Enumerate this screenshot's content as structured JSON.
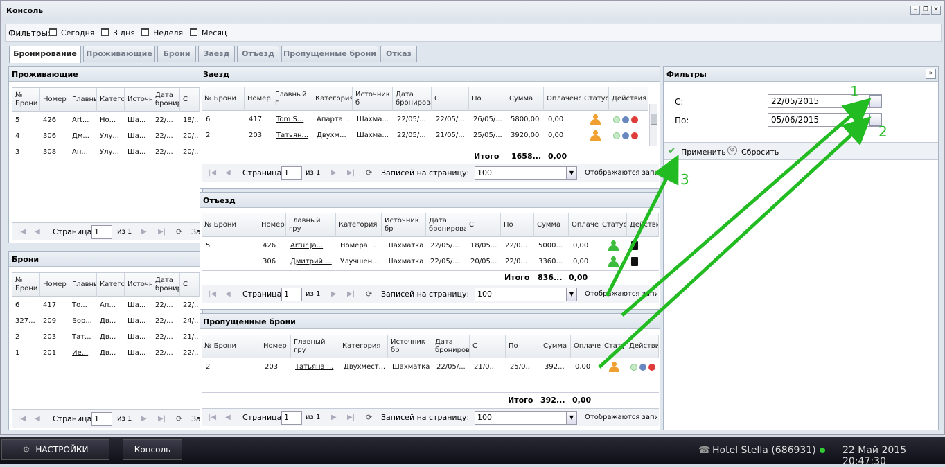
{
  "window": {
    "title": "Консоль"
  },
  "filterbar": {
    "label": "Фильтры:",
    "items": [
      "Сегодня",
      "3 дня",
      "Неделя",
      "Месяц"
    ]
  },
  "tabs": [
    "Бронирование",
    "Проживающие",
    "Брони",
    "Заезд",
    "Отъезд",
    "Пропущенные брони",
    "Отказ"
  ],
  "residents": {
    "title": "Проживающие",
    "headers": [
      "№ Брони",
      "Номер",
      "Главны",
      "Катего",
      "Источн",
      "Дата бронир",
      "С"
    ],
    "rows": [
      [
        "5",
        "426",
        "Art...",
        "Но...",
        "Ша...",
        "22/...",
        "18/..."
      ],
      [
        "4",
        "306",
        "Дм...",
        "Улу...",
        "Ша...",
        "22/...",
        "20/..."
      ],
      [
        "3",
        "308",
        "Ан...",
        "Улу...",
        "Ша...",
        "22/...",
        "20/..."
      ]
    ]
  },
  "bookings": {
    "title": "Брони",
    "headers": [
      "№ Брони",
      "Номер",
      "Главны",
      "Катего",
      "Источн",
      "Дата бронир",
      "С"
    ],
    "rows": [
      [
        "6",
        "417",
        "То...",
        "Ап...",
        "Ша...",
        "22/...",
        "22/..."
      ],
      [
        "327...",
        "209",
        "Бор...",
        "Дв...",
        "Ша...",
        "22/...",
        "24/..."
      ],
      [
        "2",
        "203",
        "Тат...",
        "Дв...",
        "Ша...",
        "22/...",
        "21/..."
      ],
      [
        "1",
        "201",
        "Ие...",
        "Дв...",
        "Ша...",
        "22/...",
        "22/..."
      ]
    ]
  },
  "arrival": {
    "title": "Заезд",
    "headers": [
      "№ Брони",
      "Номер",
      "Главный г",
      "Категория",
      "Источник б",
      "Дата бронирования",
      "С",
      "По",
      "Сумма",
      "Оплачено",
      "Статус",
      "Действия"
    ],
    "rows": [
      [
        "6",
        "417",
        "Tom S...",
        "Апарта...",
        "Шахма...",
        "22/05/...",
        "22/05/...",
        "26/05/...",
        "5800,00",
        "0,00"
      ],
      [
        "2",
        "203",
        "Татьян...",
        "Двухм...",
        "Шахма...",
        "22/05/...",
        "21/05/...",
        "25/05/...",
        "3920,00",
        "0,00"
      ]
    ],
    "total_label": "Итого",
    "total_sum": "1658...",
    "total_paid": "0,00"
  },
  "departure": {
    "title": "Отъезд",
    "headers": [
      "№ Брони",
      "Номер",
      "Главный гру",
      "Категория",
      "Источник бр",
      "Дата бронирования",
      "С",
      "По",
      "Сумма",
      "Оплачено",
      "Статус",
      "Действия"
    ],
    "rows": [
      [
        "5",
        "426",
        "Artur Ja...",
        "Номера ...",
        "Шахматка",
        "22/05/...",
        "18/05...",
        "22/0...",
        "5000...",
        "0,00"
      ],
      [
        "",
        "306",
        "Дмитрий ...",
        "Улучшен...",
        "Шахматка",
        "22/05/...",
        "20/05...",
        "22/0...",
        "3360...",
        "0,00"
      ]
    ],
    "total_label": "Итого",
    "total_sum": "836...",
    "total_paid": "0,00"
  },
  "missed": {
    "title": "Пропущенные брони",
    "headers": [
      "№ Брони",
      "Номер",
      "Главный гру",
      "Категория",
      "Источник бр",
      "Дата бронирования",
      "С",
      "По",
      "Сумма",
      "Оплачено",
      "Статус",
      "Действия"
    ],
    "rows": [
      [
        "2",
        "203",
        "Татьяна ...",
        "Двухмест...",
        "Шахматка",
        "22/05/...",
        "21/0...",
        "25/0...",
        "392...",
        "0,00"
      ]
    ],
    "total_label": "Итого",
    "total_sum": "392...",
    "total_paid": "0,00"
  },
  "pager": {
    "page_label": "Страница",
    "page": "1",
    "of": "из 1",
    "per_page_label": "Записей на страницу:",
    "per_page": "100",
    "shown_label": "Отображаются записи"
  },
  "pager_short": {
    "truncated": "За"
  },
  "filters_panel": {
    "title": "Фильтры",
    "from_label": "С:",
    "from_value": "22/05/2015",
    "to_label": "По:",
    "to_value": "05/06/2015",
    "apply": "Применить",
    "reset": "Сбросить"
  },
  "annotations": [
    "1",
    "2",
    "3"
  ],
  "taskbar": {
    "settings": "НАСТРОЙКИ",
    "console": "Консоль",
    "hotel": "Hotel Stella (686931)",
    "datetime": "22 Май 2015 20:47:30"
  },
  "colors": {
    "arrow": "#22bb22",
    "status_orange": "#f0a030",
    "status_green": "#3cbc3c"
  }
}
